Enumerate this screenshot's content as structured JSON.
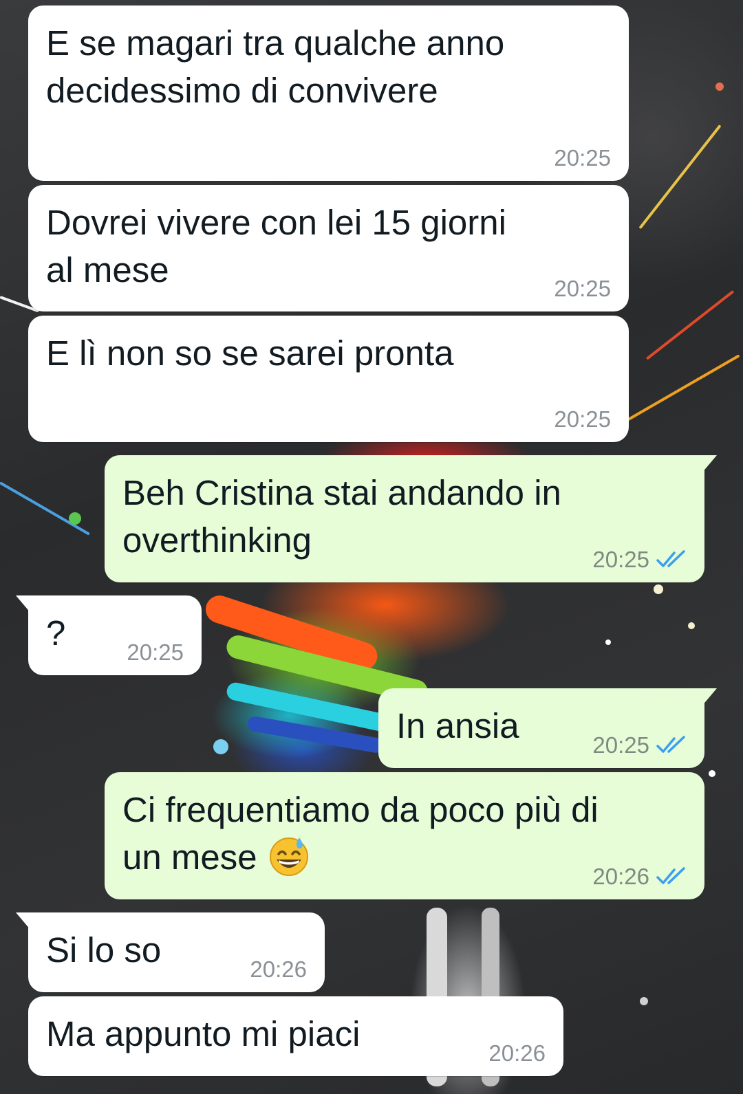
{
  "colors": {
    "incoming_bubble": "#ffffff",
    "outgoing_bubble": "#e7fdd8",
    "text": "#111b21",
    "timestamp": "#8a9096",
    "read_ticks": "#3b9ff0"
  },
  "messages": [
    {
      "direction": "incoming",
      "text": "E se magari tra qualche anno\ndecidessimo di convivere",
      "time": "20:25"
    },
    {
      "direction": "incoming",
      "text": "Dovrei vivere con lei 15 giorni\nal mese",
      "time": "20:25"
    },
    {
      "direction": "incoming",
      "text": "E lì non so se sarei pronta",
      "time": "20:25"
    },
    {
      "direction": "outgoing",
      "text": "Beh Cristina stai andando in\noverthinking",
      "time": "20:25",
      "status_icon": "double-check-read-icon"
    },
    {
      "direction": "incoming",
      "text": "?",
      "time": "20:25"
    },
    {
      "direction": "outgoing",
      "text": "In ansia",
      "time": "20:25",
      "status_icon": "double-check-read-icon"
    },
    {
      "direction": "outgoing",
      "text": "Ci frequentiamo da poco più di\nun mese ",
      "emoji": "grinning-face-with-sweat-emoji",
      "time": "20:26",
      "status_icon": "double-check-read-icon"
    },
    {
      "direction": "incoming",
      "text": "Si lo so",
      "time": "20:26"
    },
    {
      "direction": "incoming",
      "text": "Ma appunto mi piaci",
      "time": "20:26"
    }
  ]
}
